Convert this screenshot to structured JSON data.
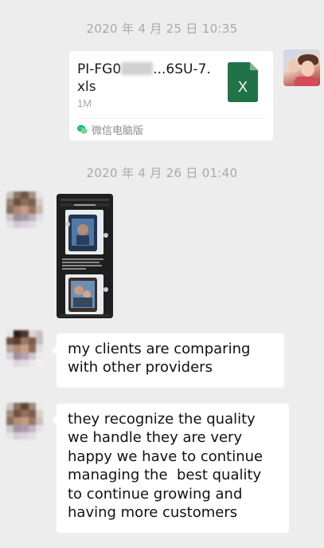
{
  "timestamps": {
    "first": "2020 年 4 月 25 日 10:35",
    "second": "2020 年 4 月 26 日 01:40"
  },
  "file_message": {
    "name_prefix": "PI-FG0",
    "name_suffix": "...6SU-7.xls",
    "size": "1M",
    "source": "微信电脑版",
    "file_icon": "excel-icon",
    "icon_letter": "X",
    "icon_color": "#217346"
  },
  "image_message": {
    "icon": "phone-screenshot-thumbnail"
  },
  "messages": [
    {
      "text": "my clients are comparing with other providers"
    },
    {
      "text": "they recognize the quality we handle they are very happy we have to continue managing the  best quality to continue growing and having more customers"
    }
  ],
  "colors": {
    "background": "#ededed",
    "bubble": "#ffffff",
    "timestamp": "#a9a9a9",
    "wechat_green": "#07c160"
  }
}
